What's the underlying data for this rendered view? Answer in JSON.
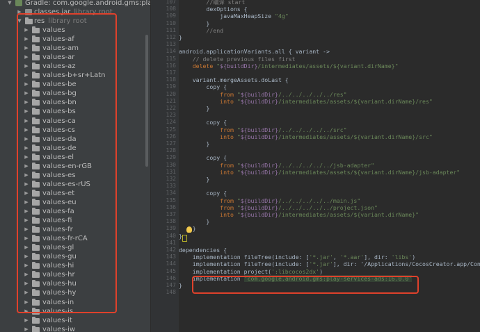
{
  "project_tree": {
    "gradle_item": "Gradle: com.google.android.gms:play-services",
    "classes_jar": {
      "name": "classes.jar",
      "suffix": "library root"
    },
    "res_folder": {
      "name": "res",
      "suffix": "library root"
    },
    "values_folders": [
      "values",
      "values-af",
      "values-am",
      "values-ar",
      "values-az",
      "values-b+sr+Latn",
      "values-be",
      "values-bg",
      "values-bn",
      "values-bs",
      "values-ca",
      "values-cs",
      "values-da",
      "values-de",
      "values-el",
      "values-en-rGB",
      "values-es",
      "values-es-rUS",
      "values-et",
      "values-eu",
      "values-fa",
      "values-fi",
      "values-fr",
      "values-fr-rCA",
      "values-gl",
      "values-gu",
      "values-hi",
      "values-hr",
      "values-hu",
      "values-hy",
      "values-in",
      "values-is",
      "values-it",
      "values-iw"
    ]
  },
  "editor": {
    "lines": [
      {
        "n": "107",
        "text": "        //编译 start",
        "cls": "c"
      },
      {
        "n": "108",
        "text": "        dexOptions {",
        "cls": ""
      },
      {
        "n": "109",
        "text": "            javaMaxHeapSize \"4g\"",
        "cls": ""
      },
      {
        "n": "110",
        "text": "        }",
        "cls": ""
      },
      {
        "n": "111",
        "text": "        //end",
        "cls": "c"
      },
      {
        "n": "112",
        "text": "}",
        "cls": ""
      },
      {
        "n": "113",
        "text": "",
        "cls": ""
      },
      {
        "n": "114",
        "text": "android.applicationVariants.all { variant ->",
        "cls": ""
      },
      {
        "n": "115",
        "text": "    // delete previous files first",
        "cls": "c"
      },
      {
        "n": "116",
        "text": "    delete \"${buildDir}/intermediates/assets/${variant.dirName}\"",
        "cls": ""
      },
      {
        "n": "117",
        "text": "",
        "cls": ""
      },
      {
        "n": "118",
        "text": "    variant.mergeAssets.doLast {",
        "cls": ""
      },
      {
        "n": "119",
        "text": "        copy {",
        "cls": ""
      },
      {
        "n": "120",
        "text": "            from \"${buildDir}/../../../../../res\"",
        "cls": ""
      },
      {
        "n": "121",
        "text": "            into \"${buildDir}/intermediates/assets/${variant.dirName}/res\"",
        "cls": ""
      },
      {
        "n": "122",
        "text": "        }",
        "cls": ""
      },
      {
        "n": "123",
        "text": "",
        "cls": ""
      },
      {
        "n": "124",
        "text": "        copy {",
        "cls": ""
      },
      {
        "n": "125",
        "text": "            from \"${buildDir}/../../../../../src\"",
        "cls": ""
      },
      {
        "n": "126",
        "text": "            into \"${buildDir}/intermediates/assets/${variant.dirName}/src\"",
        "cls": ""
      },
      {
        "n": "127",
        "text": "        }",
        "cls": ""
      },
      {
        "n": "128",
        "text": "",
        "cls": ""
      },
      {
        "n": "129",
        "text": "        copy {",
        "cls": ""
      },
      {
        "n": "130",
        "text": "            from \"${buildDir}/../../../../../jsb-adapter\"",
        "cls": ""
      },
      {
        "n": "131",
        "text": "            into \"${buildDir}/intermediates/assets/${variant.dirName}/jsb-adapter\"",
        "cls": ""
      },
      {
        "n": "132",
        "text": "        }",
        "cls": ""
      },
      {
        "n": "133",
        "text": "",
        "cls": ""
      },
      {
        "n": "134",
        "text": "        copy {",
        "cls": ""
      },
      {
        "n": "135",
        "text": "            from \"${buildDir}/../../../../../main.js\"",
        "cls": ""
      },
      {
        "n": "136",
        "text": "            from \"${buildDir}/../../../../../project.json\"",
        "cls": ""
      },
      {
        "n": "137",
        "text": "            into \"${buildDir}/intermediates/assets/${variant.dirName}\"",
        "cls": ""
      },
      {
        "n": "138",
        "text": "        }",
        "cls": ""
      },
      {
        "n": "139",
        "text": "    }",
        "cls": ""
      },
      {
        "n": "140",
        "text": "}",
        "cls": ""
      },
      {
        "n": "141",
        "text": "",
        "cls": ""
      },
      {
        "n": "142",
        "text": "dependencies {",
        "cls": ""
      },
      {
        "n": "143",
        "text": "    implementation fileTree(include: ['*.jar', '*.aar'], dir: 'libs')",
        "cls": ""
      },
      {
        "n": "144",
        "text": "    implementation fileTree(include: ['*.jar'], dir: '/Applications/CocosCreator.app/Cont",
        "cls": ""
      },
      {
        "n": "145",
        "text": "    implementation project(':libcocos2dx')",
        "cls": ""
      },
      {
        "n": "146",
        "text": "    implementation 'com.google.android.gms:play-services-ads:16.0.0'",
        "cls": "hl"
      },
      {
        "n": "147",
        "text": "}",
        "cls": ""
      },
      {
        "n": "148",
        "text": "",
        "cls": ""
      }
    ]
  },
  "colors": {
    "annotation_box": "#e0412b",
    "keyword": "#cc7832",
    "string": "#6a8759",
    "comment": "#808080",
    "variable": "#9876aa"
  }
}
